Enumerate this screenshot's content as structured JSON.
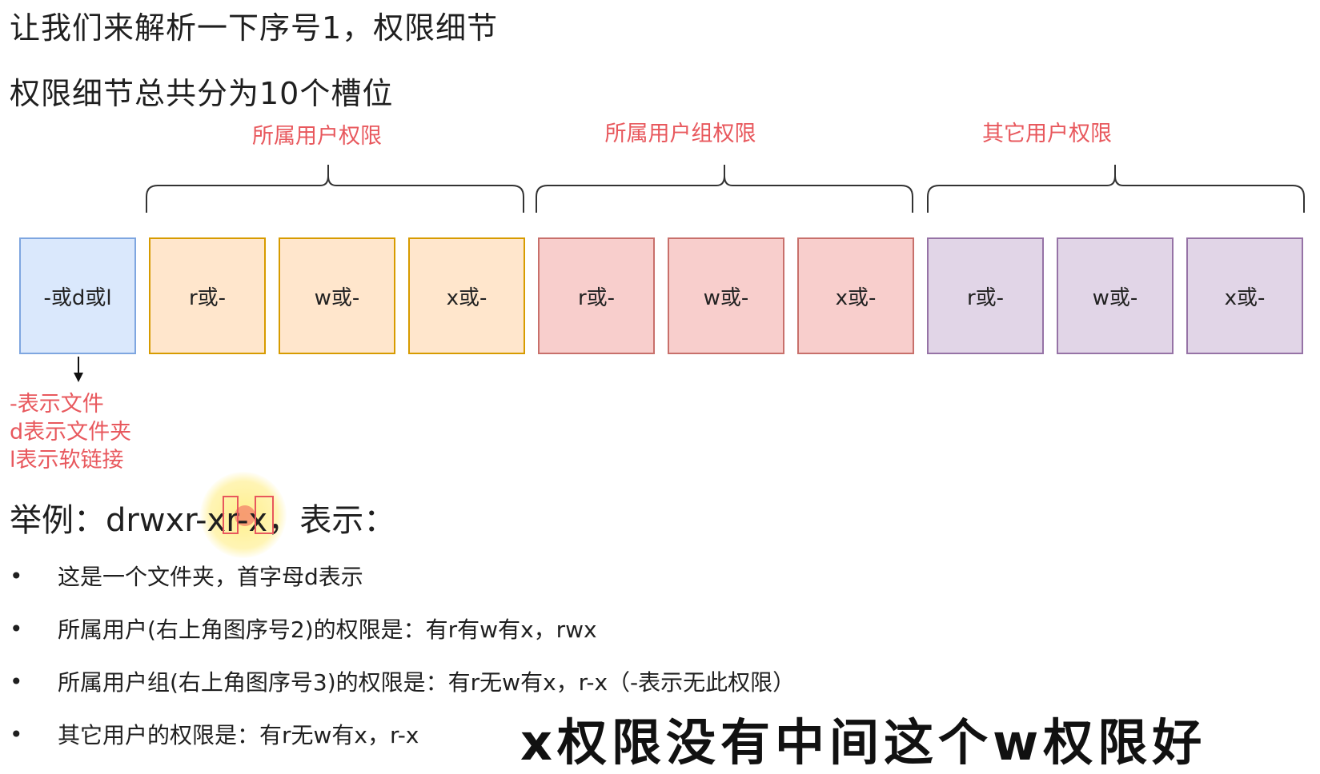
{
  "heading1": "让我们来解析一下序号1，权限细节",
  "heading2": "权限细节总共分为10个槽位",
  "group_labels": {
    "owner": "所属用户权限",
    "group": "所属用户组权限",
    "other": "其它用户权限"
  },
  "slots": [
    "-或d或l",
    "r或-",
    "w或-",
    "x或-",
    "r或-",
    "w或-",
    "x或-",
    "r或-",
    "w或-",
    "x或-"
  ],
  "type_legend": [
    "-表示文件",
    "d表示文件夹",
    "l表示软链接"
  ],
  "example": {
    "prefix": "举例：",
    "value": "drwxr-xr-x",
    "suffix": "，表示："
  },
  "bullets": [
    "这是一个文件夹，首字母d表示",
    "所属用户(右上角图序号2)的权限是：有r有w有x，rwx",
    "所属用户组(右上角图序号3)的权限是：有r无w有x，r-x（-表示无此权限）",
    "其它用户的权限是：有r无w有x，r-x"
  ],
  "caption": "x权限没有中间这个w权限好",
  "colors": {
    "accent_red": "#e8585d",
    "type_fill": "#dae8fc",
    "owner_fill": "#ffe6cc",
    "group_fill": "#f8cecc",
    "other_fill": "#e1d5e7"
  }
}
